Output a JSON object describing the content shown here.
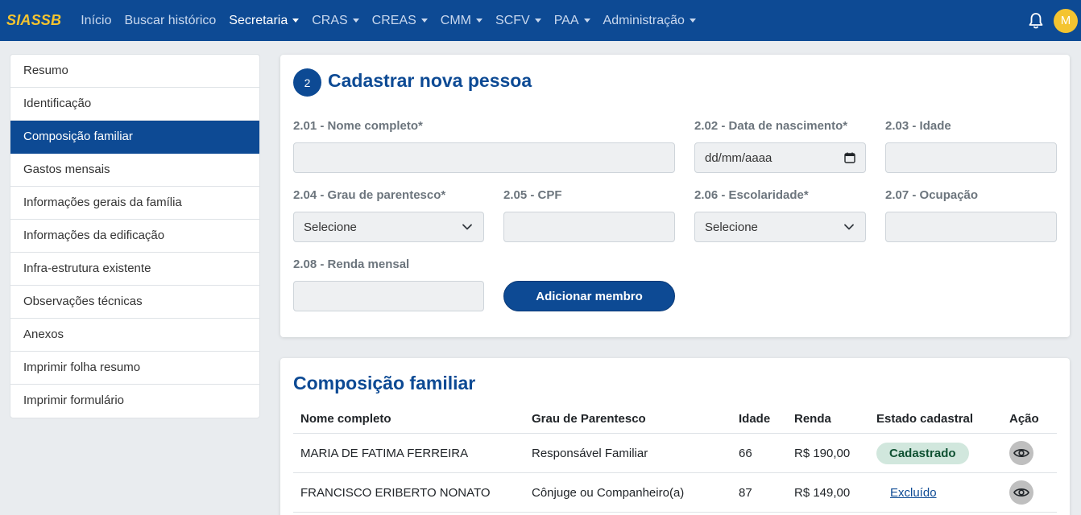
{
  "navbar": {
    "brand": "SIASSB",
    "items": [
      {
        "label": "Início",
        "dropdown": false,
        "active": false
      },
      {
        "label": "Buscar histórico",
        "dropdown": false,
        "active": false
      },
      {
        "label": "Secretaria",
        "dropdown": true,
        "active": true
      },
      {
        "label": "CRAS",
        "dropdown": true,
        "active": false
      },
      {
        "label": "CREAS",
        "dropdown": true,
        "active": false
      },
      {
        "label": "CMM",
        "dropdown": true,
        "active": false
      },
      {
        "label": "SCFV",
        "dropdown": true,
        "active": false
      },
      {
        "label": "PAA",
        "dropdown": true,
        "active": false
      },
      {
        "label": "Administração",
        "dropdown": true,
        "active": false
      }
    ],
    "notifications_icon": "bell-icon",
    "avatar_initial": "M"
  },
  "sidebar": {
    "items": [
      {
        "label": "Resumo"
      },
      {
        "label": "Identificação"
      },
      {
        "label": "Composição familiar",
        "active": true
      },
      {
        "label": "Gastos mensais"
      },
      {
        "label": "Informações gerais da família"
      },
      {
        "label": "Informações da edificação"
      },
      {
        "label": "Infra-estrutura existente"
      },
      {
        "label": "Observações técnicas"
      },
      {
        "label": "Anexos"
      },
      {
        "label": "Imprimir folha resumo"
      },
      {
        "label": "Imprimir formulário"
      }
    ]
  },
  "form": {
    "step": "2",
    "title": "Cadastrar nova pessoa",
    "fields": {
      "nome": {
        "label": "2.01 - Nome completo*",
        "value": ""
      },
      "nascimento": {
        "label": "2.02 - Data de nascimento*",
        "placeholder": "dd/mm/aaaa"
      },
      "idade": {
        "label": "2.03 - Idade",
        "value": ""
      },
      "parentesco": {
        "label": "2.04 - Grau de parentesco*",
        "selected": "Selecione"
      },
      "cpf": {
        "label": "2.05 - CPF",
        "value": ""
      },
      "escolaridade": {
        "label": "2.06 - Escolaridade*",
        "selected": "Selecione"
      },
      "ocupacao": {
        "label": "2.07 - Ocupação",
        "value": ""
      },
      "renda": {
        "label": "2.08 - Renda mensal",
        "value": ""
      }
    },
    "submit_label": "Adicionar membro"
  },
  "family": {
    "title": "Composição familiar",
    "columns": [
      "Nome completo",
      "Grau de Parentesco",
      "Idade",
      "Renda",
      "Estado cadastral",
      "Ação"
    ],
    "rows": [
      {
        "nome": "MARIA DE FATIMA FERREIRA",
        "parentesco": "Responsável Familiar",
        "idade": "66",
        "renda": "R$ 190,00",
        "estado": "Cadastrado",
        "estado_style": "badge"
      },
      {
        "nome": "FRANCISCO ERIBERTO NONATO",
        "parentesco": "Cônjuge ou Companheiro(a)",
        "idade": "87",
        "renda": "R$ 149,00",
        "estado": "Excluído",
        "estado_style": "link"
      }
    ],
    "action_icon": "eye-icon"
  },
  "colors": {
    "primary": "#0d4a94",
    "brand_yellow": "#f4c430",
    "success_bg": "#d1e7dd",
    "success_text": "#0f5132"
  }
}
